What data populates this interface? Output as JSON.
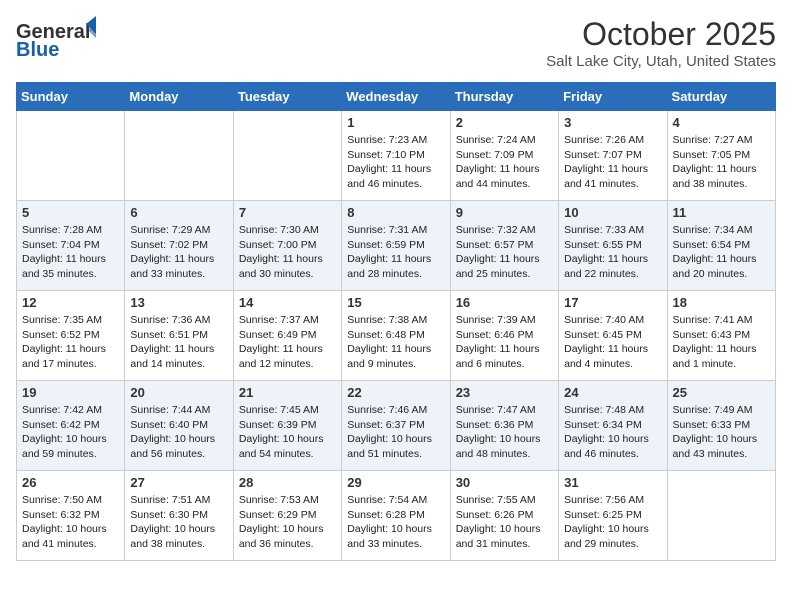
{
  "header": {
    "logo_general": "General",
    "logo_blue": "Blue",
    "month": "October 2025",
    "location": "Salt Lake City, Utah, United States"
  },
  "weekdays": [
    "Sunday",
    "Monday",
    "Tuesday",
    "Wednesday",
    "Thursday",
    "Friday",
    "Saturday"
  ],
  "weeks": [
    [
      {
        "day": "",
        "info": ""
      },
      {
        "day": "",
        "info": ""
      },
      {
        "day": "",
        "info": ""
      },
      {
        "day": "1",
        "info": "Sunrise: 7:23 AM\nSunset: 7:10 PM\nDaylight: 11 hours and 46 minutes."
      },
      {
        "day": "2",
        "info": "Sunrise: 7:24 AM\nSunset: 7:09 PM\nDaylight: 11 hours and 44 minutes."
      },
      {
        "day": "3",
        "info": "Sunrise: 7:26 AM\nSunset: 7:07 PM\nDaylight: 11 hours and 41 minutes."
      },
      {
        "day": "4",
        "info": "Sunrise: 7:27 AM\nSunset: 7:05 PM\nDaylight: 11 hours and 38 minutes."
      }
    ],
    [
      {
        "day": "5",
        "info": "Sunrise: 7:28 AM\nSunset: 7:04 PM\nDaylight: 11 hours and 35 minutes."
      },
      {
        "day": "6",
        "info": "Sunrise: 7:29 AM\nSunset: 7:02 PM\nDaylight: 11 hours and 33 minutes."
      },
      {
        "day": "7",
        "info": "Sunrise: 7:30 AM\nSunset: 7:00 PM\nDaylight: 11 hours and 30 minutes."
      },
      {
        "day": "8",
        "info": "Sunrise: 7:31 AM\nSunset: 6:59 PM\nDaylight: 11 hours and 28 minutes."
      },
      {
        "day": "9",
        "info": "Sunrise: 7:32 AM\nSunset: 6:57 PM\nDaylight: 11 hours and 25 minutes."
      },
      {
        "day": "10",
        "info": "Sunrise: 7:33 AM\nSunset: 6:55 PM\nDaylight: 11 hours and 22 minutes."
      },
      {
        "day": "11",
        "info": "Sunrise: 7:34 AM\nSunset: 6:54 PM\nDaylight: 11 hours and 20 minutes."
      }
    ],
    [
      {
        "day": "12",
        "info": "Sunrise: 7:35 AM\nSunset: 6:52 PM\nDaylight: 11 hours and 17 minutes."
      },
      {
        "day": "13",
        "info": "Sunrise: 7:36 AM\nSunset: 6:51 PM\nDaylight: 11 hours and 14 minutes."
      },
      {
        "day": "14",
        "info": "Sunrise: 7:37 AM\nSunset: 6:49 PM\nDaylight: 11 hours and 12 minutes."
      },
      {
        "day": "15",
        "info": "Sunrise: 7:38 AM\nSunset: 6:48 PM\nDaylight: 11 hours and 9 minutes."
      },
      {
        "day": "16",
        "info": "Sunrise: 7:39 AM\nSunset: 6:46 PM\nDaylight: 11 hours and 6 minutes."
      },
      {
        "day": "17",
        "info": "Sunrise: 7:40 AM\nSunset: 6:45 PM\nDaylight: 11 hours and 4 minutes."
      },
      {
        "day": "18",
        "info": "Sunrise: 7:41 AM\nSunset: 6:43 PM\nDaylight: 11 hours and 1 minute."
      }
    ],
    [
      {
        "day": "19",
        "info": "Sunrise: 7:42 AM\nSunset: 6:42 PM\nDaylight: 10 hours and 59 minutes."
      },
      {
        "day": "20",
        "info": "Sunrise: 7:44 AM\nSunset: 6:40 PM\nDaylight: 10 hours and 56 minutes."
      },
      {
        "day": "21",
        "info": "Sunrise: 7:45 AM\nSunset: 6:39 PM\nDaylight: 10 hours and 54 minutes."
      },
      {
        "day": "22",
        "info": "Sunrise: 7:46 AM\nSunset: 6:37 PM\nDaylight: 10 hours and 51 minutes."
      },
      {
        "day": "23",
        "info": "Sunrise: 7:47 AM\nSunset: 6:36 PM\nDaylight: 10 hours and 48 minutes."
      },
      {
        "day": "24",
        "info": "Sunrise: 7:48 AM\nSunset: 6:34 PM\nDaylight: 10 hours and 46 minutes."
      },
      {
        "day": "25",
        "info": "Sunrise: 7:49 AM\nSunset: 6:33 PM\nDaylight: 10 hours and 43 minutes."
      }
    ],
    [
      {
        "day": "26",
        "info": "Sunrise: 7:50 AM\nSunset: 6:32 PM\nDaylight: 10 hours and 41 minutes."
      },
      {
        "day": "27",
        "info": "Sunrise: 7:51 AM\nSunset: 6:30 PM\nDaylight: 10 hours and 38 minutes."
      },
      {
        "day": "28",
        "info": "Sunrise: 7:53 AM\nSunset: 6:29 PM\nDaylight: 10 hours and 36 minutes."
      },
      {
        "day": "29",
        "info": "Sunrise: 7:54 AM\nSunset: 6:28 PM\nDaylight: 10 hours and 33 minutes."
      },
      {
        "day": "30",
        "info": "Sunrise: 7:55 AM\nSunset: 6:26 PM\nDaylight: 10 hours and 31 minutes."
      },
      {
        "day": "31",
        "info": "Sunrise: 7:56 AM\nSunset: 6:25 PM\nDaylight: 10 hours and 29 minutes."
      },
      {
        "day": "",
        "info": ""
      }
    ]
  ]
}
